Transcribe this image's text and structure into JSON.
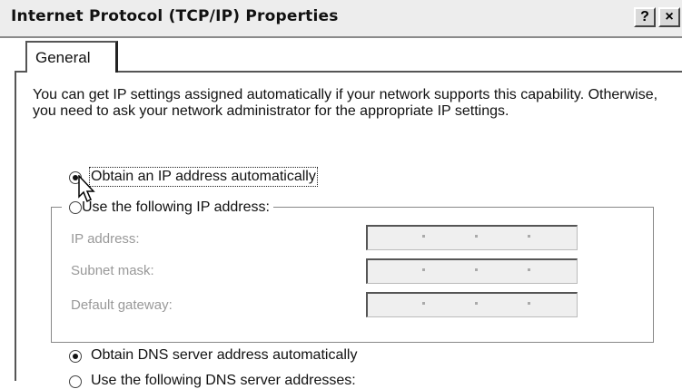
{
  "window": {
    "title": "Internet Protocol (TCP/IP) Properties",
    "help_label": "?",
    "close_label": "×"
  },
  "tabs": [
    {
      "label": "General",
      "selected": true
    }
  ],
  "description": "You can get IP settings assigned automatically if your network supports this capability. Otherwise, you need to ask your network administrator for the appropriate IP settings.",
  "ip_options": {
    "auto_label": "Obtain an IP address automatically",
    "auto_selected": true,
    "manual_label": "Use the following IP address:",
    "manual_selected": false
  },
  "ip_fields": [
    {
      "label": "IP address:",
      "value": ".   .   ."
    },
    {
      "label": "Subnet mask:",
      "value": ".   .   ."
    },
    {
      "label": "Default gateway:",
      "value": ".   .   ."
    }
  ],
  "dns_options": {
    "auto_label": "Obtain DNS server address automatically",
    "auto_selected": true,
    "manual_label": "Use the following DNS server addresses:",
    "manual_selected": false
  }
}
